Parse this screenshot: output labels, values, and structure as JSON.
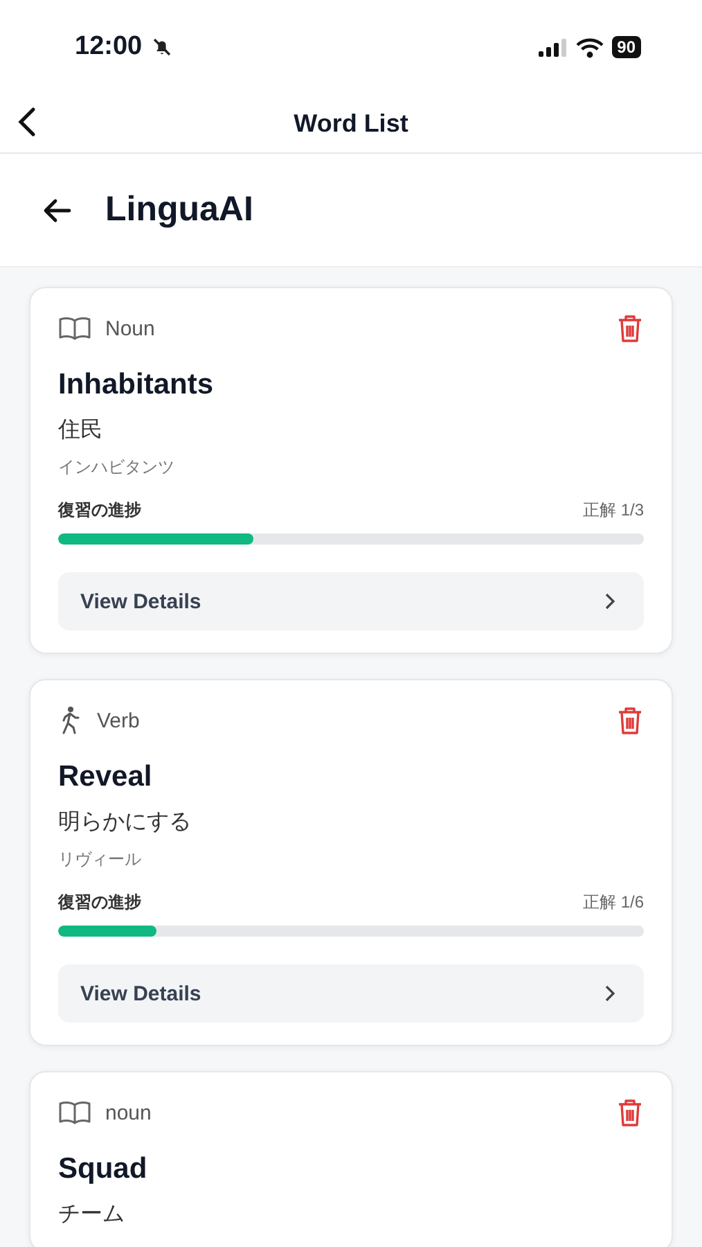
{
  "status_bar": {
    "time": "12:00",
    "silent": true,
    "battery": "90"
  },
  "nav_bar": {
    "title": "Word List"
  },
  "header": {
    "title": "LinguaAI"
  },
  "words": [
    {
      "kind": "book",
      "part_of_speech": "Noun",
      "word": "Inhabitants",
      "meaning": "住民",
      "reading": "インハビタンツ",
      "progress_label": "復習の進捗",
      "score": "正解 1/3",
      "level": 0.333,
      "action": "View Details"
    },
    {
      "kind": "walk",
      "part_of_speech": "Verb",
      "word": "Reveal",
      "meaning": "明らかにする",
      "reading": "リヴィール",
      "progress_label": "復習の進捗",
      "score": "正解 1/6",
      "level": 0.167,
      "action": "View Details"
    },
    {
      "kind": "book",
      "part_of_speech": "noun",
      "word": "Squad",
      "meaning": "チーム"
    }
  ]
}
